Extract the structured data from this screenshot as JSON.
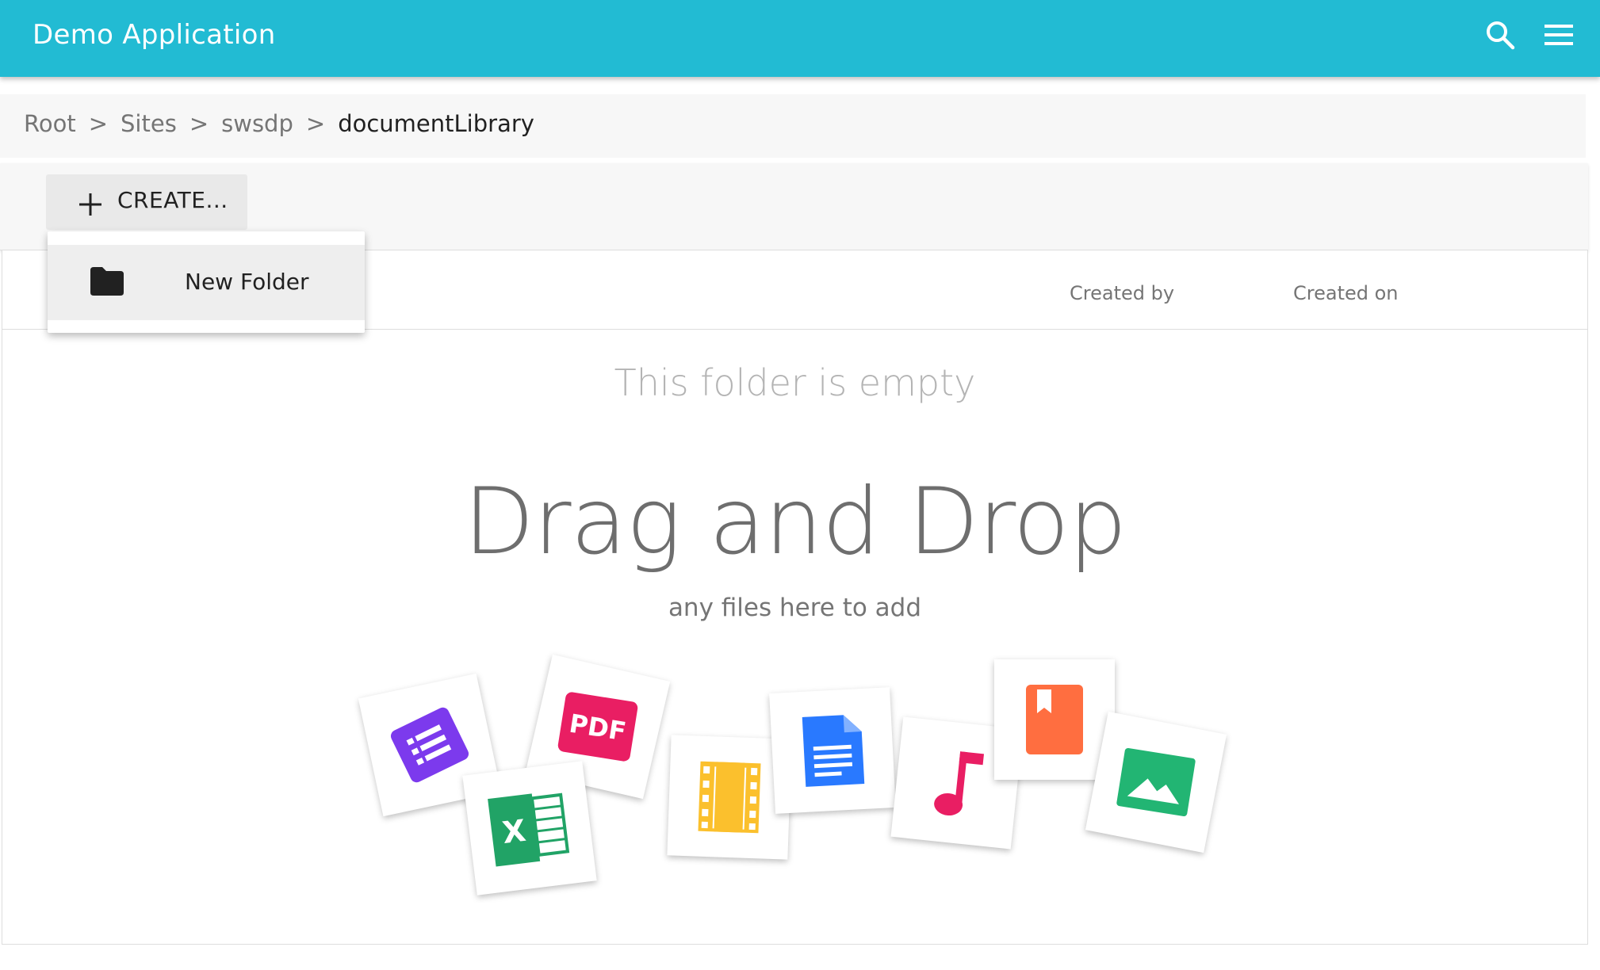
{
  "app": {
    "title": "Demo Application"
  },
  "icons": {
    "search": "search-icon",
    "menu": "menu-icon",
    "plus": "plus-icon",
    "folder": "folder-icon"
  },
  "colors": {
    "appbar": "#22bbd3",
    "forms": "#7c3aed",
    "excel": "#21a366",
    "pdf": "#e91e63",
    "video": "#fbc02d",
    "docs": "#2979ff",
    "music": "#e91e63",
    "book": "#ff6e40",
    "image": "#22b573"
  },
  "breadcrumb": {
    "items": [
      "Root",
      "Sites",
      "swsdp",
      "documentLibrary"
    ],
    "separator": ">"
  },
  "toolbar": {
    "create_label": "CREATE..."
  },
  "create_menu": {
    "items": [
      {
        "label": "New Folder",
        "icon": "folder-icon"
      }
    ]
  },
  "table": {
    "columns": [
      "Created by",
      "Created on"
    ]
  },
  "empty_state": {
    "title": "This folder is empty",
    "drag_title": "Drag and Drop",
    "drag_subtitle": "any files here to add",
    "file_types": [
      "form-icon",
      "excel-icon",
      "pdf-icon",
      "video-icon",
      "document-icon",
      "music-icon",
      "book-icon",
      "image-icon"
    ],
    "pdf_text": "PDF",
    "excel_text": "X"
  }
}
